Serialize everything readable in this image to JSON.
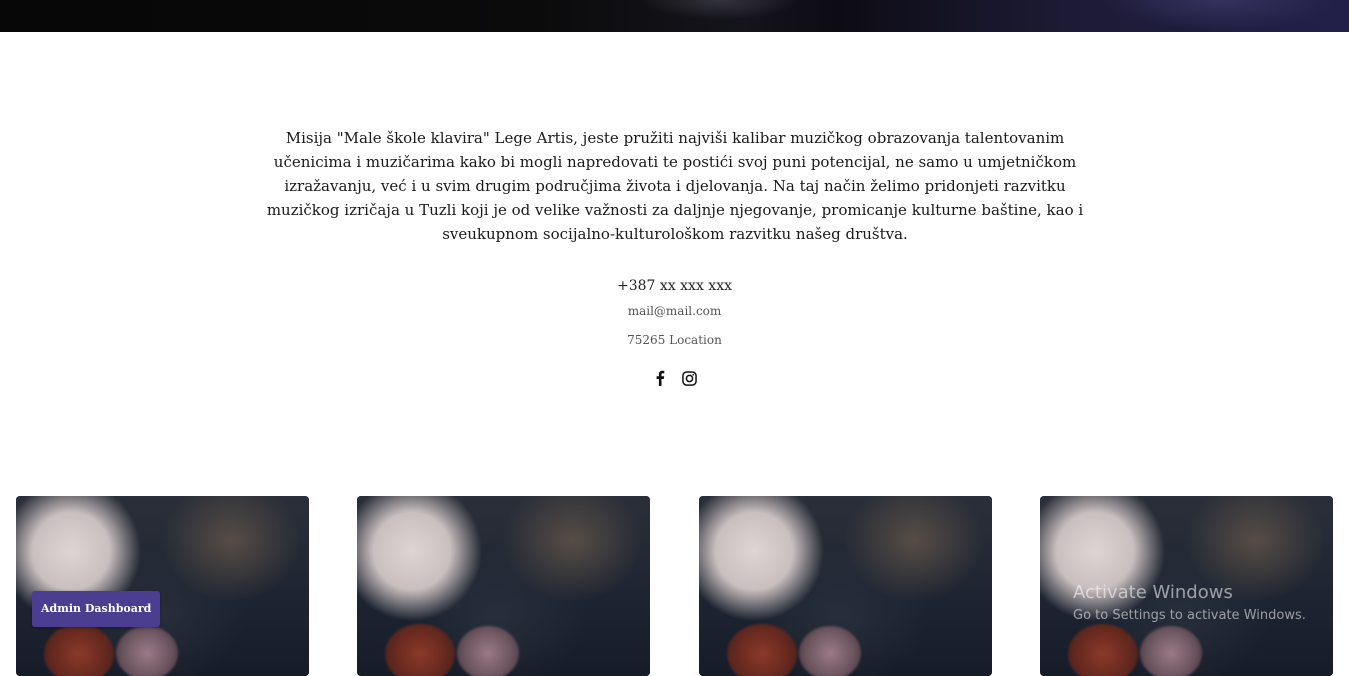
{
  "mission": {
    "text": "Misija \"Male škole klavira\" Lege Artis, jeste pružiti najviši kalibar muzičkog obrazovanja talentovanim učenicima i muzičarima kako bi mogli napredovati te postići svoj puni potencijal, ne samo u umjetničkom izražavanju, već i u svim drugim područjima života i djelovanja. Na taj način želimo pridonjeti razvitku muzičkog izričaja u Tuzli koji je od velike važnosti za daljnje njegovanje, promicanje kulturne baštine, kao i sveukupnom socijalno-kulturološkom razvitku našeg društva."
  },
  "contact": {
    "phone": "+387 xx xxx xxx",
    "email": "mail@mail.com",
    "location": "75265 Location"
  },
  "socials": [
    {
      "icon": "facebook-icon"
    },
    {
      "icon": "instagram-icon"
    }
  ],
  "admin": {
    "label": "Admin Dashboard",
    "color": "#4b3d8f"
  },
  "watermark": {
    "title": "Activate Windows",
    "subtitle": "Go to Settings to activate Windows."
  }
}
